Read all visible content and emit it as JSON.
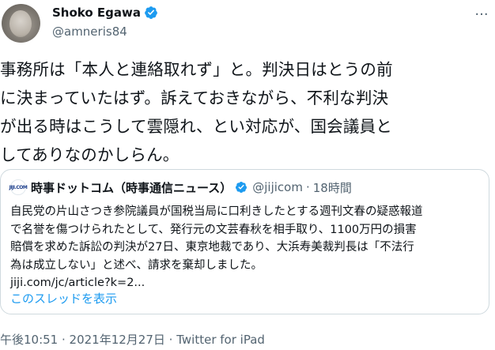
{
  "author": {
    "display_name": "Shoko Egawa",
    "handle": "@amneris84",
    "more_icon": "more-dots-icon"
  },
  "tweet": {
    "text": "事務所は「本人と連絡取れず」と。判決日はとうの前\nに決まっていたはず。訴えておきながら、不利な判決\nが出る時はこうして雲隠れ、とい対応が、国会議員と\nしてありなのかしらん。"
  },
  "quoted": {
    "avatar_label": "JIJI.COM",
    "name": "時事ドットコム（時事通信ニュース）",
    "handle": "@jijicom",
    "separator": "·",
    "time": "18時間",
    "text": "自民党の片山さつき参院議員が国税当局に口利きしたとする週刊文春の疑惑報道\nで名誉を傷つけられたとして、発行元の文芸春秋を相手取り、1100万円の損害\n賠償を求めた訴訟の判決が27日、東京地裁であり、大浜寿美裁判長は「不法行\n為は成立しない」と述べ、請求を棄却しました。\njiji.com/jc/article?k=2...",
    "thread_link": "このスレッドを表示"
  },
  "meta": {
    "time": "午後10:51",
    "sep1": " · ",
    "date": "2021年12月27日",
    "sep2": " · ",
    "source": "Twitter for iPad"
  },
  "colors": {
    "verified": "#1d9bf0",
    "link": "#1d9bf0",
    "secondary_text": "#536471",
    "border": "#cfd9de"
  }
}
